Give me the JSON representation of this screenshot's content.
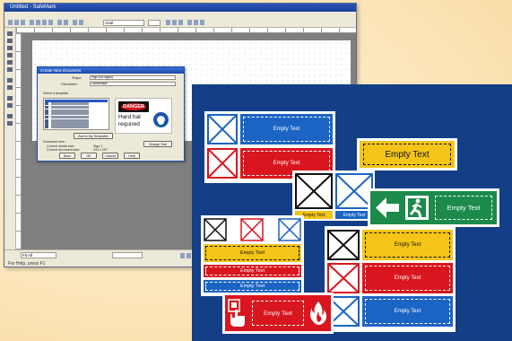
{
  "app": {
    "window_title": "Untitled - SafeMark",
    "status_text": "For Help, press F1",
    "zoom_value": "Fit All",
    "font_box": "Arial"
  },
  "dialog": {
    "title": "Create New Document",
    "shape_label": "Shape:",
    "shape_value": "Sign (no signs)",
    "orientation_label": "Orientation:",
    "orientation_value": "Landscape",
    "template_label": "Select a template:",
    "template_items": [
      "Templates",
      "1 sign on A4",
      "2 signs on A4",
      "3 signs on A4",
      "4 signs on A4",
      "5 signs on A4",
      "6 signs on A4",
      "7 signs on A4",
      "8 signs on A4",
      "9 signs on A4"
    ],
    "add_button": "Add to My Templates",
    "doc_size_label": "Document size:",
    "current_media_label": "Current media size:",
    "current_media_value": "Sign 1",
    "current_doc_label": "Current document size:",
    "current_doc_value": "210 x 297",
    "change_button": "Change Size",
    "back_button": "Back",
    "ok_button": "OK",
    "cancel_button": "Cancel",
    "help_button": "Help",
    "preview_danger": "DANGER",
    "preview_text": "Hard hat required"
  },
  "signs": {
    "empty_text": "Empty Text"
  },
  "colors": {
    "panel": "#143e86",
    "sign_blue": "#1b64c4",
    "sign_red": "#d9161f",
    "sign_yellow": "#f4c418",
    "sign_green": "#1b8a4a"
  }
}
